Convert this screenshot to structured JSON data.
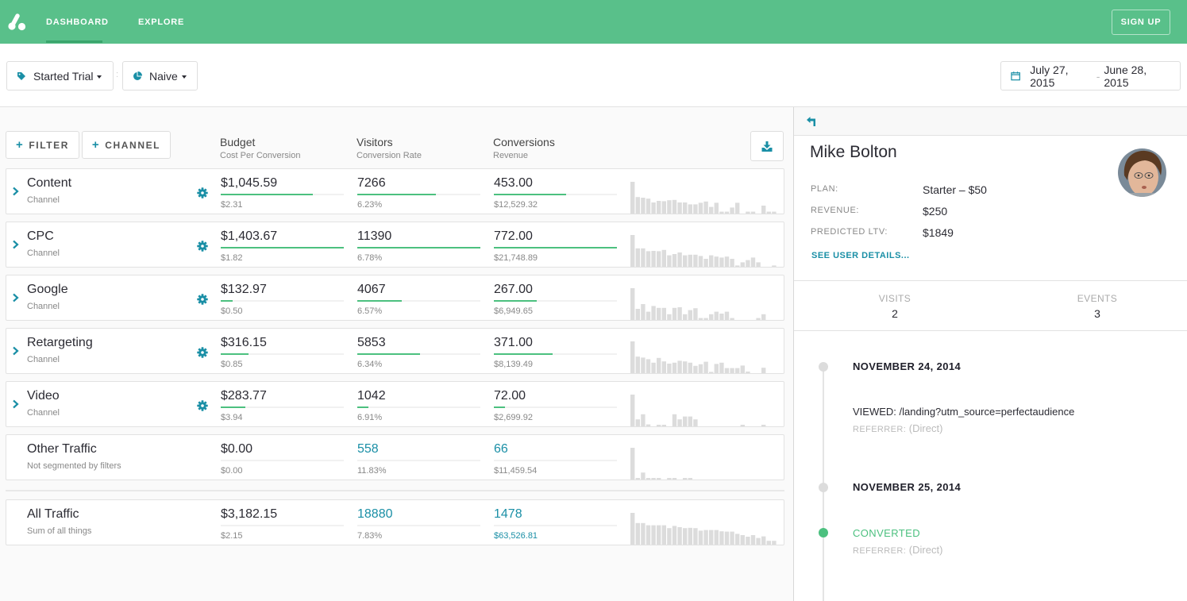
{
  "nav": {
    "items": [
      "DASHBOARD",
      "EXPLORE"
    ],
    "active": "DASHBOARD",
    "signup_label": "SIGN UP"
  },
  "toolbar": {
    "event_select": "Started Trial",
    "separator": ":",
    "model_select": "Naive",
    "date_start": "July 27, 2015",
    "date_sep": "-",
    "date_end": "June 28, 2015"
  },
  "table": {
    "filter_label": "FILTER",
    "channel_label": "CHANNEL",
    "columns": [
      {
        "title": "Budget",
        "subtitle": "Cost Per Conversion"
      },
      {
        "title": "Visitors",
        "subtitle": "Conversion Rate"
      },
      {
        "title": "Conversions",
        "subtitle": "Revenue"
      }
    ],
    "rows": [
      {
        "name": "Content",
        "sub": "Channel",
        "budget": "$1,045.59",
        "budget_fill": 0.75,
        "cpc": "$2.31",
        "visitors": "7266",
        "visitors_fill": 0.64,
        "rate": "6.23%",
        "conversions": "453.00",
        "conv_fill": 0.59,
        "revenue": "$12,529.32",
        "spark": [
          100,
          52,
          50,
          47,
          35,
          40,
          39,
          42,
          43,
          35,
          35,
          29,
          29,
          34,
          38,
          21,
          34,
          6,
          6,
          19,
          34,
          0,
          6,
          6,
          0,
          25,
          6,
          6
        ]
      },
      {
        "name": "CPC",
        "sub": "Channel",
        "budget": "$1,403.67",
        "budget_fill": 1.0,
        "cpc": "$1.82",
        "visitors": "11390",
        "visitors_fill": 1.0,
        "rate": "6.78%",
        "conversions": "772.00",
        "conv_fill": 1.0,
        "revenue": "$21,748.89",
        "spark": [
          100,
          58,
          58,
          49,
          50,
          49,
          53,
          36,
          40,
          45,
          36,
          38,
          38,
          34,
          25,
          36,
          32,
          29,
          32,
          25,
          4,
          14,
          21,
          29,
          14,
          0,
          0,
          4
        ]
      },
      {
        "name": "Google",
        "sub": "Channel",
        "budget": "$132.97",
        "budget_fill": 0.095,
        "cpc": "$0.50",
        "visitors": "4067",
        "visitors_fill": 0.36,
        "rate": "6.57%",
        "conversions": "267.00",
        "conv_fill": 0.35,
        "revenue": "$6,949.65",
        "spark": [
          100,
          35,
          50,
          26,
          44,
          38,
          38,
          18,
          38,
          40,
          18,
          31,
          37,
          6,
          6,
          18,
          26,
          20,
          26,
          6,
          0,
          0,
          0,
          0,
          6,
          18,
          0,
          0
        ]
      },
      {
        "name": "Retargeting",
        "sub": "Channel",
        "budget": "$316.15",
        "budget_fill": 0.225,
        "cpc": "$0.85",
        "visitors": "5853",
        "visitors_fill": 0.51,
        "rate": "6.34%",
        "conversions": "371.00",
        "conv_fill": 0.48,
        "revenue": "$8,139.49",
        "spark": [
          100,
          52,
          49,
          44,
          33,
          48,
          37,
          30,
          33,
          39,
          37,
          33,
          23,
          28,
          36,
          4,
          29,
          33,
          16,
          16,
          16,
          24,
          5,
          0,
          0,
          17,
          0,
          0
        ]
      },
      {
        "name": "Video",
        "sub": "Channel",
        "budget": "$283.77",
        "budget_fill": 0.2,
        "cpc": "$3.94",
        "visitors": "1042",
        "visitors_fill": 0.09,
        "rate": "6.91%",
        "conversions": "72.00",
        "conv_fill": 0.09,
        "revenue": "$2,699.92",
        "spark": [
          100,
          22,
          38,
          6,
          0,
          5,
          5,
          0,
          38,
          22,
          31,
          31,
          22,
          0,
          0,
          0,
          0,
          0,
          0,
          0,
          0,
          5,
          0,
          0,
          0,
          5,
          0,
          0
        ]
      }
    ],
    "other": {
      "name": "Other Traffic",
      "sub": "Not segmented by filters",
      "budget": "$0.00",
      "cpc": "$0.00",
      "visitors": "558",
      "rate": "11.83%",
      "conversions": "66",
      "revenue": "$11,459.54",
      "spark": [
        100,
        5,
        22,
        5,
        5,
        5,
        0,
        5,
        5,
        0,
        5,
        5,
        0,
        0,
        0,
        0,
        0,
        0,
        0,
        0,
        0,
        0,
        0,
        0,
        0,
        0,
        0,
        0
      ]
    },
    "total": {
      "name": "All Traffic",
      "sub": "Sum of all things",
      "budget": "$3,182.15",
      "cpc": "$2.15",
      "visitors": "18880",
      "rate": "7.83%",
      "conversions": "1478",
      "revenue": "$63,526.81",
      "spark": [
        100,
        68,
        68,
        61,
        61,
        61,
        61,
        52,
        59,
        55,
        52,
        53,
        52,
        44,
        46,
        46,
        46,
        42,
        41,
        41,
        34,
        30,
        25,
        30,
        21,
        26,
        12,
        12
      ]
    }
  },
  "user": {
    "name": "Mike Bolton",
    "fields": [
      {
        "label": "PLAN:",
        "value": "Starter – $50"
      },
      {
        "label": "REVENUE:",
        "value": "$250"
      },
      {
        "label": "PREDICTED LTV:",
        "value": "$1849"
      }
    ],
    "details_link": "SEE USER DETAILS...",
    "stats": [
      {
        "label": "VISITS",
        "value": "2"
      },
      {
        "label": "EVENTS",
        "value": "3"
      }
    ],
    "timeline": [
      {
        "date": "NOVEMBER 24, 2014",
        "event": "VIEWED: /landing?utm_source=perfectaudience",
        "ref_label": "REFERRER:",
        "ref_value": "(Direct)"
      },
      {
        "date": "NOVEMBER 25, 2014",
        "event": "CONVERTED",
        "ref_label": "REFERRER:",
        "ref_value": "(Direct)"
      }
    ]
  },
  "colors": {
    "brand": "#59c08a",
    "accent": "#1a8fa6",
    "progress": "#4cc07f",
    "spark": "#dcdcdc"
  }
}
